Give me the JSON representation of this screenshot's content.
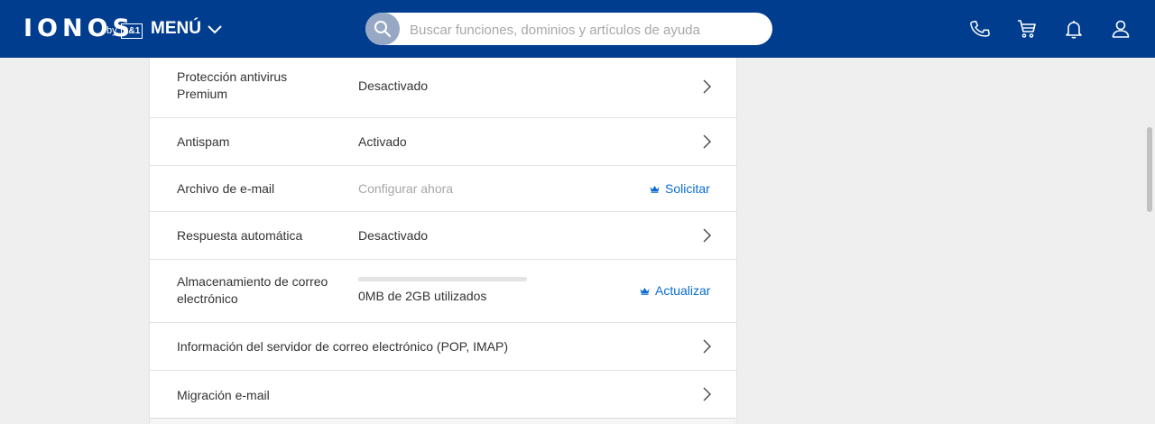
{
  "header": {
    "logo": "IONOS",
    "by": "by",
    "brand_box": "1&1",
    "menu_label": "MENÚ",
    "search_placeholder": "Buscar funciones, dominios y artículos de ayuda",
    "icons": [
      "phone-icon",
      "cart-icon",
      "bell-icon",
      "user-icon"
    ],
    "color": "#003d8f"
  },
  "settings": {
    "rows": [
      {
        "label_line1": "Protección antivirus",
        "label_line2": "Premium",
        "value": "Desactivado"
      },
      {
        "label": "Antispam",
        "value": "Activado"
      },
      {
        "label": "Archivo de e-mail",
        "value": "Configurar ahora",
        "action": "Solicitar"
      },
      {
        "label": "Respuesta automática",
        "value": "Desactivado"
      },
      {
        "label_line1": "Almacenamiento de correo",
        "label_line2": "electrónico",
        "value": "0MB de 2GB utilizados",
        "action": "Actualizar",
        "storage_used_fraction": 0
      },
      {
        "label": "Información del servidor de correo electrónico (POP, IMAP)"
      },
      {
        "label": "Migración e-mail"
      }
    ]
  },
  "colors": {
    "accent": "#0b6cd0",
    "background": "#efefef"
  }
}
